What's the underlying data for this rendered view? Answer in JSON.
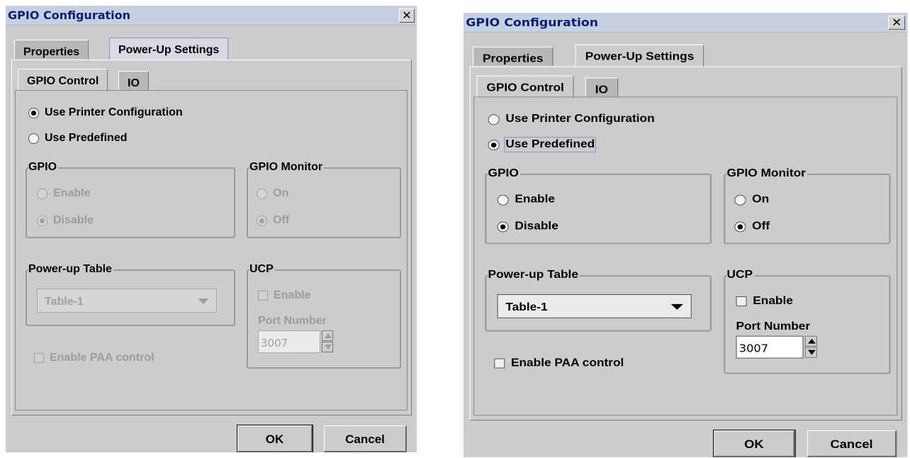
{
  "dialog_title": "GPIO Configuration",
  "close_glyph": "✕",
  "tabs_top": [
    "Properties",
    "Power-Up Settings"
  ],
  "tabs_inner": [
    "GPIO Control",
    "IO"
  ],
  "mode_options": [
    "Use Printer Configuration",
    "Use Predefined"
  ],
  "gpio": {
    "title": "GPIO",
    "options": [
      "Enable",
      "Disable"
    ]
  },
  "gpio_monitor": {
    "title": "GPIO Monitor",
    "options": [
      "On",
      "Off"
    ]
  },
  "power_up_table": {
    "title": "Power-up Table",
    "selected": "Table-1"
  },
  "ucp": {
    "title": "UCP",
    "enable_label": "Enable",
    "port_label": "Port Number",
    "port_value": "3007"
  },
  "paa_label": "Enable PAA control",
  "ok_label": "OK",
  "cancel_label": "Cancel",
  "left_dialog": {
    "mode_selected": "Use Printer Configuration",
    "controls_enabled": false
  },
  "right_dialog": {
    "mode_selected": "Use Predefined",
    "controls_enabled": true
  },
  "colors": {
    "title_bar": "#c6d0e0",
    "title_text": "#0a1f7a",
    "dialog_bg": "#cccccc",
    "disabled_text": "#9c9c9c"
  }
}
